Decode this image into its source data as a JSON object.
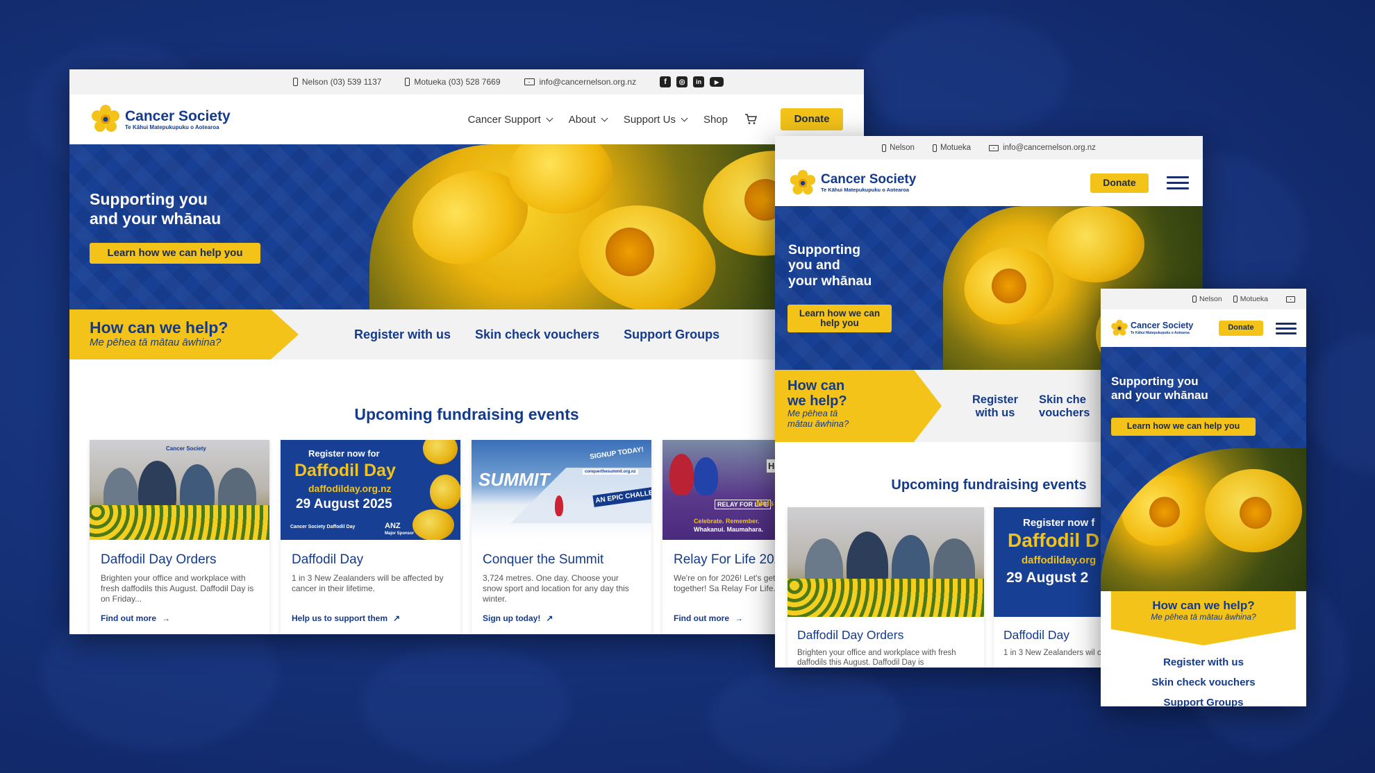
{
  "brand": {
    "name": "Cancer Society",
    "subtitle": "Te Kāhui Matepukupuku o Aotearoa",
    "color_navy": "#143a8c",
    "color_yellow": "#f3c319"
  },
  "desktop": {
    "topbar": {
      "nelson": "Nelson (03) 539 1137",
      "motueka": "Motueka (03) 528 7669",
      "email": "info@cancernelson.org.nz",
      "social_icons": [
        "facebook-icon",
        "instagram-icon",
        "linkedin-icon",
        "youtube-icon"
      ]
    },
    "nav": {
      "items": [
        "Cancer Support",
        "About",
        "Support Us",
        "Shop"
      ],
      "cart_icon": "cart-icon",
      "donate": "Donate"
    },
    "hero": {
      "title_line1": "Supporting you",
      "title_line2": "and your whānau",
      "cta": "Learn how we can help you"
    },
    "help": {
      "question": "How can we help?",
      "maori": "Me pēhea tā mātau āwhina?",
      "links": [
        "Register with us",
        "Skin check vouchers",
        "Support Groups"
      ]
    },
    "events": {
      "title": "Upcoming fundraising events",
      "cards": [
        {
          "title": "Daffodil Day Orders",
          "desc": "Brighten your office and workplace with fresh daffodils this August. Daffodil Day is on Friday...",
          "link": "Find out more",
          "img_text": "Cancer Society"
        },
        {
          "title": "Daffodil Day",
          "desc": "1 in 3 New Zealanders will be affected by cancer in their lifetime.",
          "link": "Help us to support them",
          "img_line1": "Register now for",
          "img_line2": "Daffodil Day",
          "img_line3": "daffodilday.org.nz",
          "img_line4": "29 August 2025",
          "img_logo1": "Cancer Society Daffodil Day",
          "img_logo2": "ANZ",
          "img_logo2_sub": "Major Sponsor"
        },
        {
          "title": "Conquer the Summit",
          "desc": "3,724 metres. One day. Choose your snow sport and location for any day this winter.",
          "link": "Sign up today!",
          "img_text1": "SUMMIT",
          "img_text2": "SIGNUP TODAY!",
          "img_text3": "AN EPIC CHALLENGE!",
          "img_text4": "conquerthesummit.org.nz"
        },
        {
          "title": "Relay For Life 2026",
          "desc": "We're on for 2026! Let's get remarkable together! Sa Relay For Life...",
          "link": "Find out more",
          "img_text1": "RELAY FOR LIFE",
          "img_text2": "Celebrate. Remember.",
          "img_text3": "Whakanui. Maumahara.",
          "img_text4": "Nels 14-15",
          "img_text5": "Hands"
        }
      ]
    }
  },
  "tablet": {
    "topbar": {
      "nelson": "Nelson",
      "motueka": "Motueka",
      "email": "info@cancernelson.org.nz"
    },
    "donate": "Donate",
    "hero": {
      "title_line1": "Supporting",
      "title_line2": "you and",
      "title_line3": "your whānau",
      "cta_line1": "Learn how we can",
      "cta_line2": "help you"
    },
    "help": {
      "q1": "How can",
      "q2": "we help?",
      "m1": "Me pēhea tā",
      "m2": "mātau āwhina?",
      "link1a": "Register",
      "link1b": "with us",
      "link2a": "Skin che",
      "link2b": "vouchers"
    },
    "events": {
      "title": "Upcoming fundraising events",
      "card1_title": "Daffodil Day Orders",
      "card1_desc": "Brighten your office and workplace with fresh daffodils this August. Daffodil Day is",
      "card2_title": "Daffodil Day",
      "card2_desc": "1 in 3 New Zealanders wil cancer in their lifetime.",
      "card2_img1": "Register now f",
      "card2_img2": "Daffodil D",
      "card2_img3": "daffodilday.org",
      "card2_img4": "29 August 2"
    }
  },
  "mobile": {
    "topbar": {
      "nelson": "Nelson",
      "motueka": "Motueka"
    },
    "donate": "Donate",
    "hero": {
      "title_line1": "Supporting you",
      "title_line2": "and your whānau",
      "cta": "Learn how we can help you"
    },
    "help": {
      "question": "How can we help?",
      "maori": "Me pēhea tā mātau āwhina?",
      "links": [
        "Register with us",
        "Skin check vouchers",
        "Support Groups"
      ]
    }
  }
}
